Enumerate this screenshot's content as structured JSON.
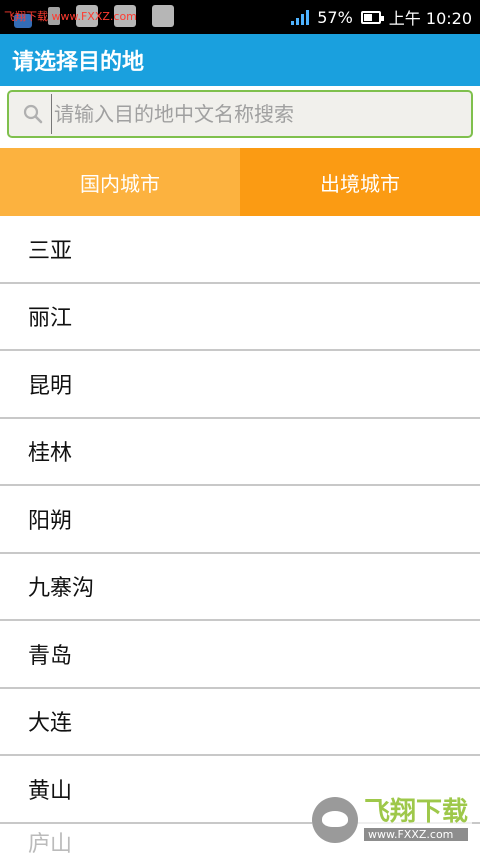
{
  "status_bar": {
    "watermark": "飞翔下载 www.FXXZ.com",
    "battery_percent": "57%",
    "time": "上午 10:20",
    "battery_level": 0.57
  },
  "header": {
    "title": "请选择目的地"
  },
  "search": {
    "placeholder": "请输入目的地中文名称搜索"
  },
  "tabs": [
    {
      "label": "国内城市"
    },
    {
      "label": "出境城市"
    }
  ],
  "cities": [
    "三亚",
    "丽江",
    "昆明",
    "桂林",
    "阳朔",
    "九寨沟",
    "青岛",
    "大连",
    "黄山",
    "庐山"
  ],
  "watermark_logo": {
    "cn": "飞翔下载",
    "url": "www.FXXZ.com"
  },
  "colors": {
    "title_bar": "#1aa0de",
    "search_border": "#7fc04d",
    "tab_domestic": "#fcb23f",
    "tab_abroad": "#fb9b13"
  }
}
